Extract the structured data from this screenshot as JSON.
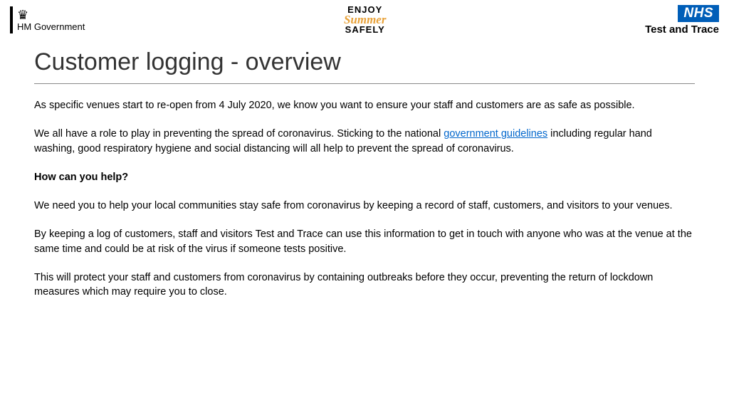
{
  "header": {
    "hmgov_label": "HM Government",
    "summer_line1": "ENJOY",
    "summer_line2": "Summer",
    "summer_line3": "SAFELY",
    "nhs_label": "NHS",
    "nhs_sub": "Test and Trace"
  },
  "title": "Customer logging - overview",
  "body": {
    "p1": "As specific venues start to re-open from 4 July 2020, we know you want to ensure your staff and customers are as safe as possible.",
    "p2_pre": "We all have a role to play in preventing the spread of coronavirus. Sticking to the national ",
    "p2_link": "government guidelines",
    "p2_post": " including regular hand washing, good respiratory hygiene and social distancing will all help to prevent the spread of coronavirus.",
    "subhead": "How can you help?",
    "p3": "We need you to help your local communities stay safe from coronavirus by keeping a record of staff, customers, and visitors to your venues.",
    "p4": "By keeping a log of customers, staff and visitors Test and Trace can use this information to get in touch with anyone who was at the venue at the same time and could be at risk of the virus if someone tests positive.",
    "p5": "This will protect your staff and customers from coronavirus by containing outbreaks before they occur, preventing the return of lockdown measures which may require you to close."
  }
}
